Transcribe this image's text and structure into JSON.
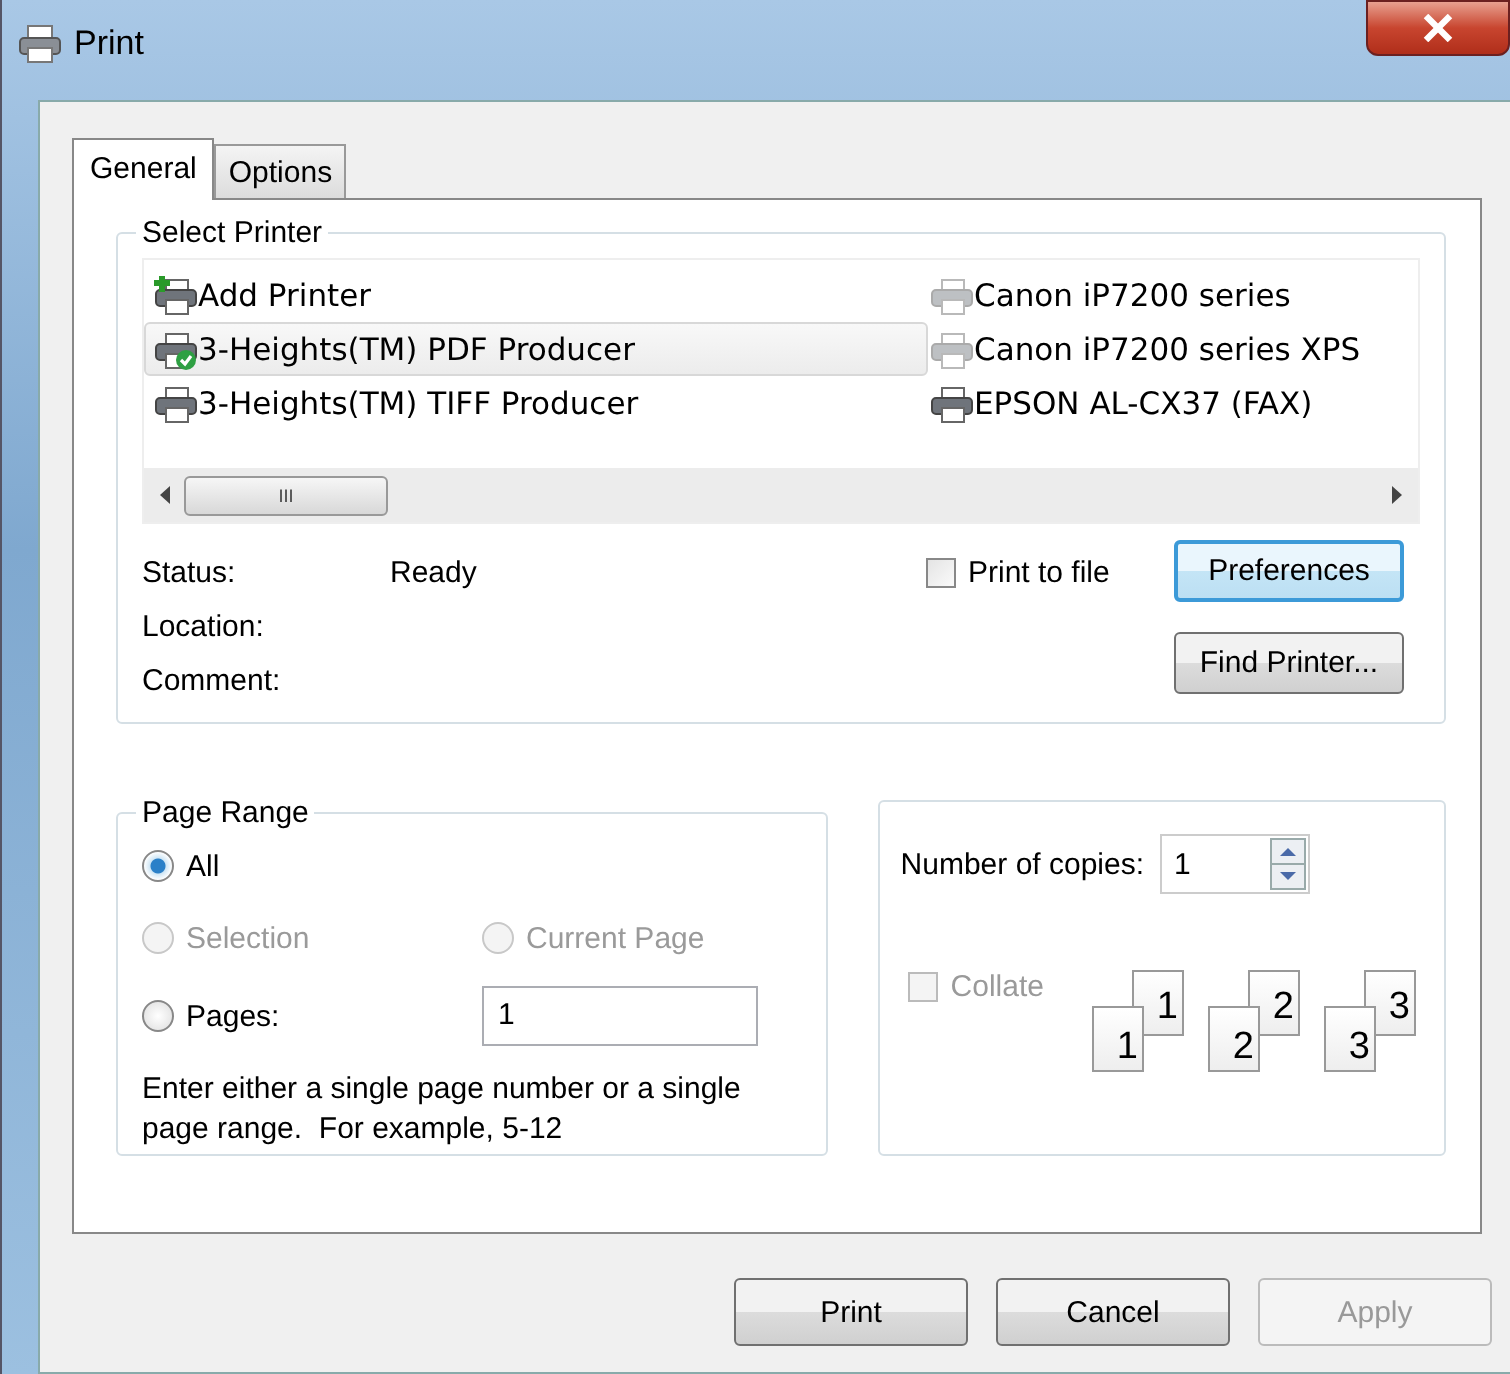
{
  "window": {
    "title": "Print"
  },
  "tabs": [
    {
      "label": "General",
      "selected": true
    },
    {
      "label": "Options",
      "selected": false
    }
  ],
  "select_printer": {
    "title": "Select Printer",
    "printers": [
      {
        "name": "Add Printer",
        "kind": "add",
        "default": false,
        "dim": false,
        "selected": false
      },
      {
        "name": "3-Heights(TM) PDF Producer",
        "kind": "printer",
        "default": true,
        "dim": false,
        "selected": true
      },
      {
        "name": "3-Heights(TM) TIFF Producer",
        "kind": "printer",
        "default": false,
        "dim": false,
        "selected": false
      },
      {
        "name": "Canon iP7200 series",
        "kind": "printer",
        "default": false,
        "dim": true,
        "selected": false
      },
      {
        "name": "Canon iP7200 series XPS",
        "kind": "printer",
        "default": false,
        "dim": true,
        "selected": false
      },
      {
        "name": "EPSON AL-CX37 (FAX)",
        "kind": "printer",
        "default": false,
        "dim": false,
        "selected": false
      }
    ],
    "scroll_thumb_grip": "III",
    "info": [
      {
        "label": "Status:",
        "value": "Ready"
      },
      {
        "label": "Location:"
      },
      {
        "label": "Comment:"
      }
    ],
    "print_to_file": {
      "label": "Print to file",
      "checked": false
    },
    "buttons": [
      {
        "label": "Preferences",
        "focused": true
      },
      {
        "label": "Find Printer...",
        "focused": false
      }
    ]
  },
  "page_range": {
    "title": "Page Range",
    "options": [
      {
        "label": "All",
        "selected": true,
        "disabled": false
      },
      {
        "label": "Selection",
        "selected": false,
        "disabled": true
      },
      {
        "label": "Current Page",
        "selected": false,
        "disabled": true
      },
      {
        "label": "Pages:",
        "selected": false,
        "disabled": false
      }
    ],
    "pages_value": "1",
    "hint": "Enter either a single page number or a single page range.  For example, 5-12"
  },
  "copies": {
    "label": "Number of copies:",
    "value": "1",
    "collate": {
      "label": "Collate",
      "checked": false,
      "disabled": true
    },
    "collate_pages": [
      {
        "front": "1",
        "back": "1"
      },
      {
        "front": "2",
        "back": "2"
      },
      {
        "front": "3",
        "back": "3"
      }
    ]
  },
  "buttons": [
    {
      "label": "Print",
      "disabled": false
    },
    {
      "label": "Cancel",
      "disabled": false
    },
    {
      "label": "Apply",
      "disabled": true
    }
  ]
}
